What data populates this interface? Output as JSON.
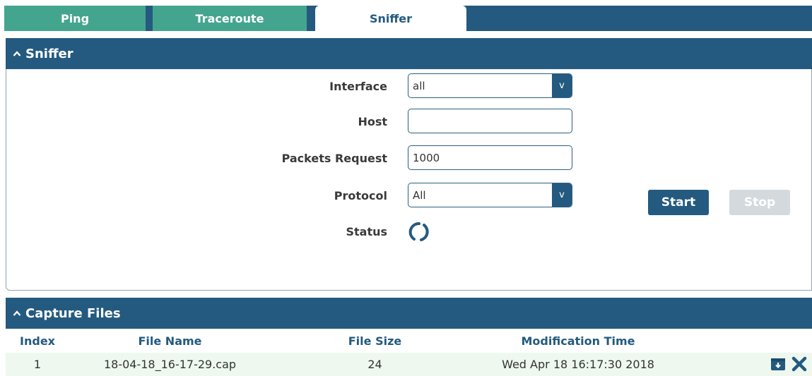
{
  "tabs": [
    {
      "label": "Ping",
      "active": false
    },
    {
      "label": "Traceroute",
      "active": false
    },
    {
      "label": "Sniffer",
      "active": true
    }
  ],
  "sniffer": {
    "title": "Sniffer",
    "fields": {
      "interface": {
        "label": "Interface",
        "value": "all"
      },
      "host": {
        "label": "Host",
        "value": "",
        "placeholder": ""
      },
      "packets_request": {
        "label": "Packets Request",
        "value": "1000"
      },
      "protocol": {
        "label": "Protocol",
        "value": "All"
      },
      "status": {
        "label": "Status",
        "icon": "loading-spinner-icon"
      }
    },
    "select_arrow": "v",
    "start_label": "Start",
    "stop_label": "Stop"
  },
  "capture_files": {
    "title": "Capture Files",
    "columns": [
      "Index",
      "File Name",
      "File Size",
      "Modification Time"
    ],
    "rows": [
      {
        "index": "1",
        "file_name": "18-04-18_16-17-29.cap",
        "file_size": "24",
        "modification_time": "Wed Apr 18 16:17:30 2018"
      }
    ],
    "row_actions": [
      "download-icon",
      "delete-icon"
    ]
  },
  "colors": {
    "primary": "#245a7f",
    "tab_inactive": "#44a58e",
    "row_highlight": "#eef8ef",
    "button_disabled": "#d4d9de"
  }
}
